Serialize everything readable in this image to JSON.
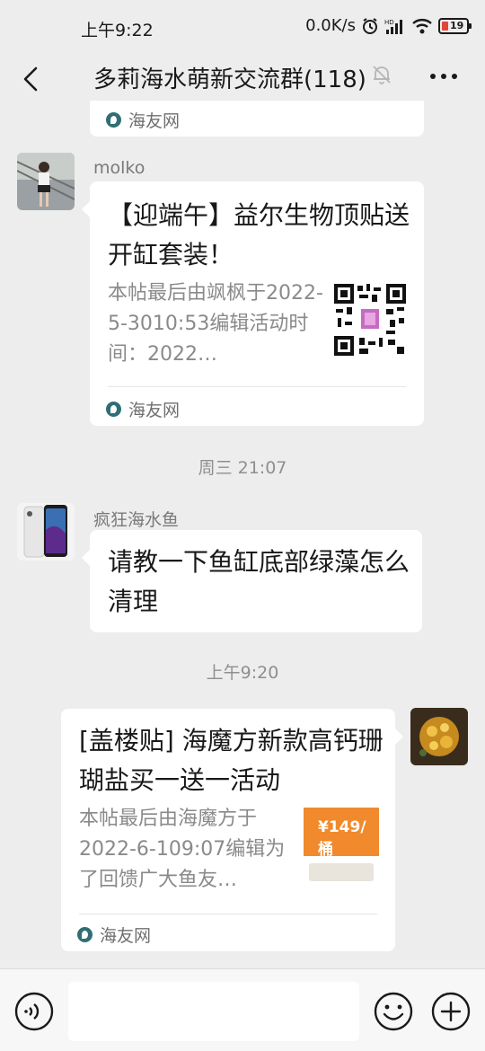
{
  "status_bar": {
    "time": "上午9:22",
    "network_speed": "0.0K/s",
    "battery": "19",
    "battery_color": "#e0463a"
  },
  "header": {
    "title": "多莉海水萌新交流群(118)",
    "back_icon": "chevron-left-icon",
    "mute_icon": "bell-off-icon",
    "more_icon": "more-dots-icon"
  },
  "messages": [
    {
      "type": "card-partial",
      "source": "海友网"
    },
    {
      "type": "card",
      "sender": "molko",
      "title": "【迎端午】益尔生物顶贴送开缸套装！",
      "description": "本帖最后由飒枫于2022-5-3010:53编辑活动时间：2022…",
      "source": "海友网"
    },
    {
      "type": "time",
      "text": "周三 21:07"
    },
    {
      "type": "text",
      "sender": "疯狂海水鱼",
      "text": "请教一下鱼缸底部绿藻怎么清理"
    },
    {
      "type": "time",
      "text": "上午9:20"
    },
    {
      "type": "card-self",
      "title": "[盖楼贴] 海魔方新款高钙珊 瑚盐买一送一活动",
      "description": "本帖最后由海魔方于2022-6-109:07编辑为了回馈广大鱼友…",
      "thumb_price": "149",
      "source": "海友网"
    }
  ],
  "input_bar": {
    "placeholder": "",
    "voice_icon": "voice-icon",
    "emoji_icon": "emoji-icon",
    "plus_icon": "plus-circle-icon"
  },
  "colors": {
    "background": "#ededed",
    "bubble": "#ffffff",
    "source_icon": "#2f6f74"
  }
}
